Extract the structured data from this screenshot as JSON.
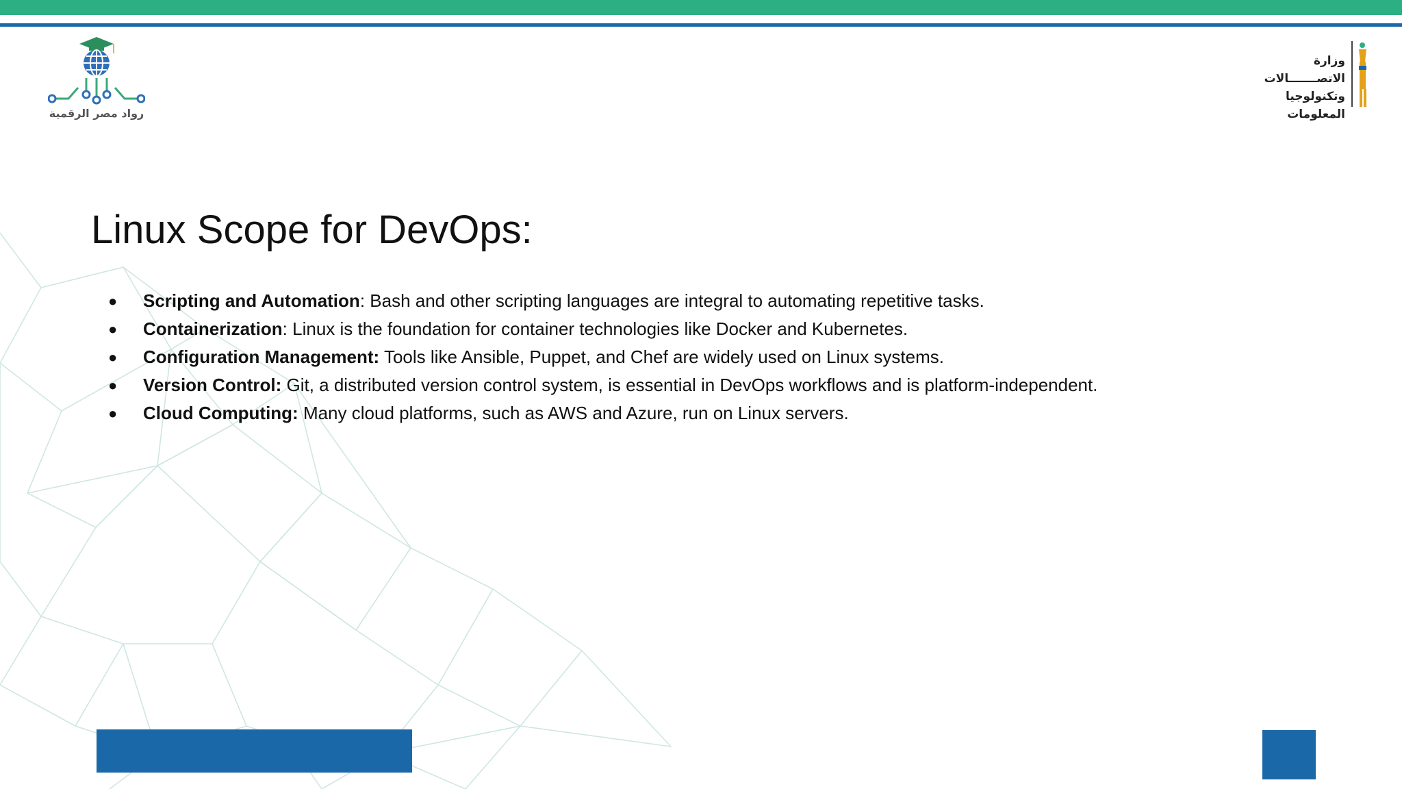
{
  "colors": {
    "accent_green": "#2daf84",
    "accent_blue": "#1b68a8",
    "mesh": "#a9d3cc"
  },
  "logos": {
    "left": {
      "name": "digital-egypt-pioneers-logo",
      "icon": "graduation-cap-globe-circuit",
      "caption": "رواد مصر الرقمية"
    },
    "right": {
      "name": "ministry-of-communications-logo",
      "icon": "pharaonic-figure",
      "line1": "وزارة الاتصـــــــالات",
      "line2": "وتكنولوجيا المعلومات"
    }
  },
  "slide": {
    "title": "Linux Scope for DevOps:",
    "bullet_marker": "●",
    "bullets": [
      {
        "term": "Scripting and Automation",
        "separator": ":",
        "text": " Bash and other scripting languages are integral to automating repetitive tasks."
      },
      {
        "term": "Containerization",
        "separator": ":",
        "text": " Linux is the foundation for container technologies like Docker and Kubernetes."
      },
      {
        "term": "Configuration Management:",
        "separator": "",
        "text": " Tools like Ansible, Puppet, and Chef are widely used on Linux systems."
      },
      {
        "term": "Version Control:",
        "separator": "",
        "text": " Git, a distributed version control system, is essential in DevOps workflows and is platform-independent."
      },
      {
        "term": "Cloud Computing:",
        "separator": "",
        "text": " Many cloud platforms, such as AWS and Azure, run on Linux servers."
      }
    ]
  }
}
